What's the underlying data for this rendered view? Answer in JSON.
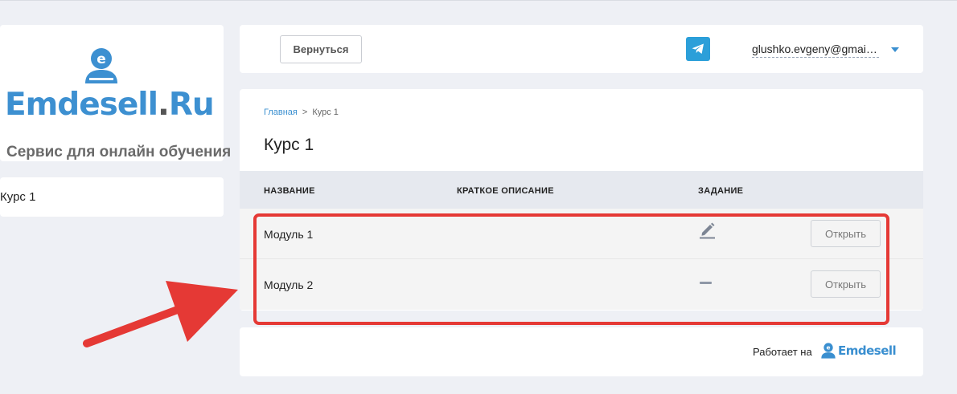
{
  "logo": {
    "brand": "Emdesell",
    "dot": ".",
    "tld": "Ru",
    "tagline": "Сервис для онлайн обучения"
  },
  "sidebar": {
    "items": [
      {
        "label": "Курс 1"
      }
    ]
  },
  "header": {
    "back_label": "Вернуться",
    "telegram_icon": "telegram-icon",
    "user_email": "glushko.evgeny@gmail.com"
  },
  "breadcrumb": {
    "home": "Главная",
    "separator": ">",
    "current": "Курс 1"
  },
  "page_title": "Курс 1",
  "table": {
    "columns": [
      "НАЗВАНИЕ",
      "КРАТКОЕ ОПИСАНИЕ",
      "ЗАДАНИЕ"
    ],
    "rows": [
      {
        "name": "Модуль 1",
        "description": "",
        "task": "pencil-icon",
        "action": "Открыть"
      },
      {
        "name": "Модуль 2",
        "description": "",
        "task": "dash-icon",
        "action": "Открыть"
      }
    ]
  },
  "footer": {
    "powered_by": "Работает на",
    "brand": "Emdesell"
  },
  "colors": {
    "accent": "#3a8fd0",
    "telegram": "#2b9fd9",
    "annotation": "#e53935",
    "background": "#eef0f5"
  }
}
